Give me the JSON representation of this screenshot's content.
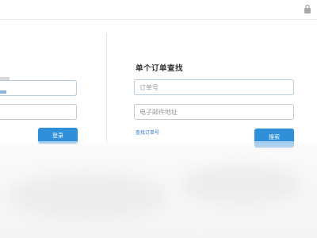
{
  "order_lookup": {
    "title": "单个订单查找",
    "order_number_placeholder": "订单号",
    "email_placeholder": "电子邮件地址",
    "find_order_link": "查找订单号",
    "search_button": "搜索"
  },
  "login": {
    "login_button": "登录"
  },
  "colors": {
    "accent": "#2f8fd9",
    "link": "#2d79c7"
  }
}
